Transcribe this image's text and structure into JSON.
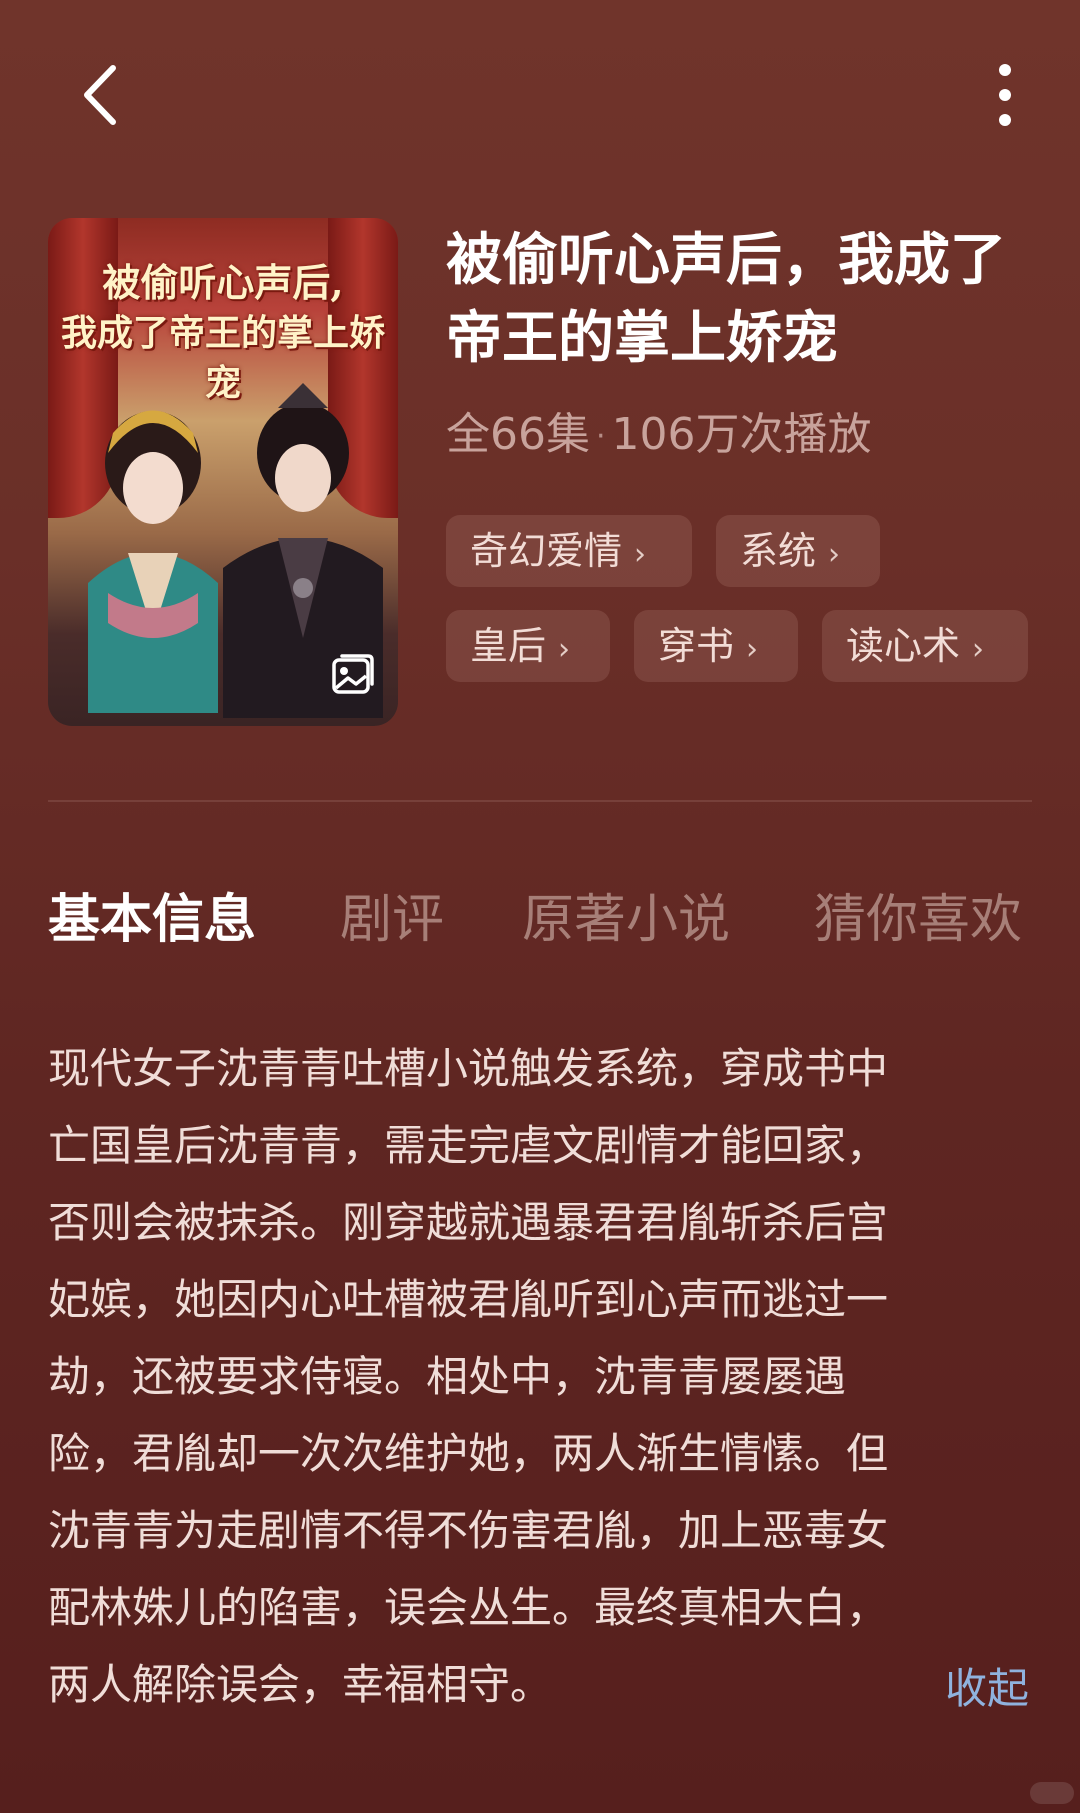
{
  "nav": {
    "back_icon": "chevron-left-icon",
    "more_icon": "more-vertical-icon"
  },
  "poster": {
    "title_line1": "被偷听心声后,",
    "title_line2": "我成了帝王的掌上娇宠",
    "photo_icon": "image-icon"
  },
  "drama": {
    "title": "被偷听心声后，我成了帝王的掌上娇宠",
    "episodes": "全66集",
    "separator": "·",
    "plays": "106万次播放"
  },
  "tags": [
    {
      "label": "奇幻爱情"
    },
    {
      "label": "系统"
    },
    {
      "label": "皇后"
    },
    {
      "label": "穿书"
    },
    {
      "label": "读心术"
    }
  ],
  "tabs": [
    {
      "label": "基本信息",
      "active": true
    },
    {
      "label": "剧评"
    },
    {
      "label": "原著小说"
    },
    {
      "label": "猜你喜欢"
    }
  ],
  "description": {
    "lines": [
      "现代女子沈青青吐槽小说触发系统，穿成书中",
      "亡国皇后沈青青，需走完虐文剧情才能回家，",
      "否则会被抹杀。刚穿越就遇暴君君胤斩杀后宫",
      "妃嫔，她因内心吐槽被君胤听到心声而逃过一",
      "劫，还被要求侍寝。相处中，沈青青屡屡遇",
      "险，君胤却一次次维护她，两人渐生情愫。但",
      "沈青青为走剧情不得不伤害君胤，加上恶毒女",
      "配林姝儿的陷害，误会丛生。最终真相大白，",
      "两人解除误会，幸福相守。"
    ],
    "collapse_label": "收起"
  },
  "colors": {
    "background": "#6a2f28",
    "accent_link": "#8fb2de",
    "tab_active": "#ffffff",
    "tab_inactive": "#a77f78"
  }
}
